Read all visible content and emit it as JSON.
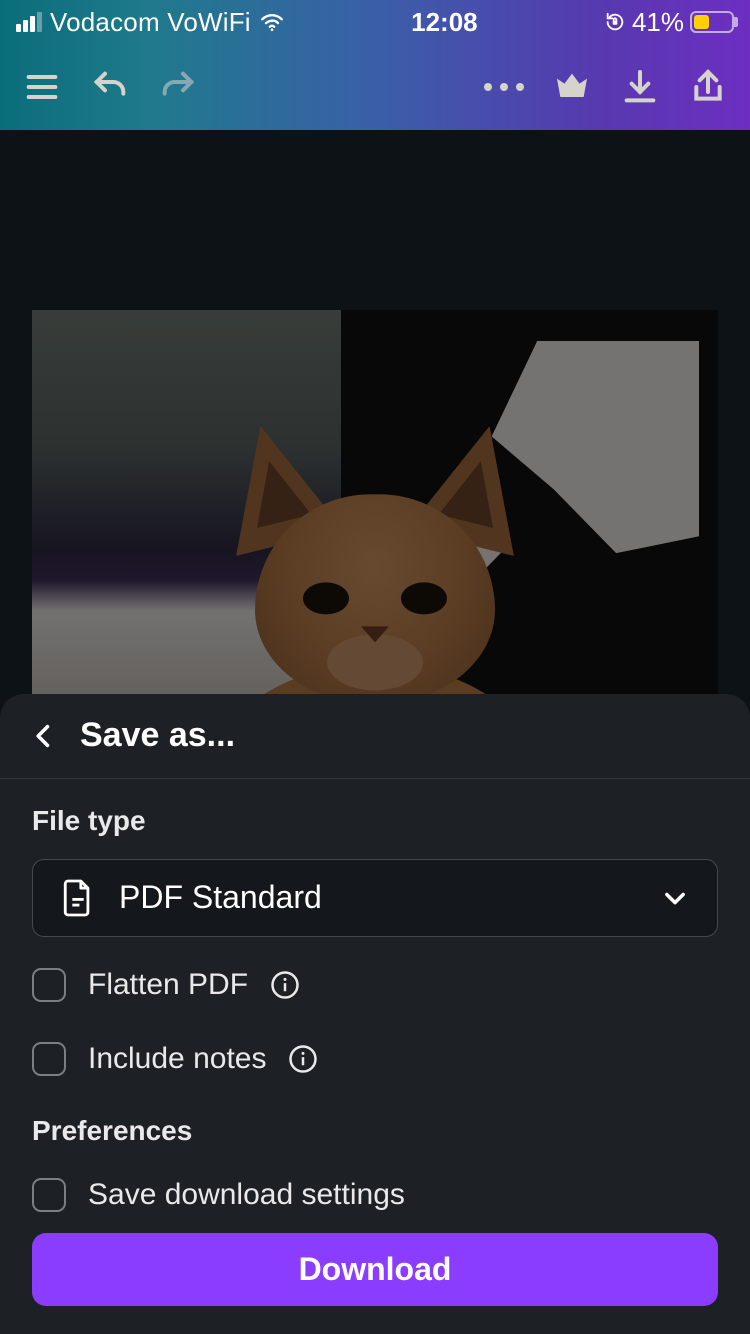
{
  "status_bar": {
    "carrier": "Vodacom VoWiFi",
    "time": "12:08",
    "battery_percent": "41%"
  },
  "sheet": {
    "title": "Save as...",
    "file_type_label": "File type",
    "file_type_value": "PDF Standard",
    "flatten_label": "Flatten PDF",
    "include_notes_label": "Include notes",
    "preferences_label": "Preferences",
    "save_settings_label": "Save download settings",
    "download_button": "Download"
  }
}
